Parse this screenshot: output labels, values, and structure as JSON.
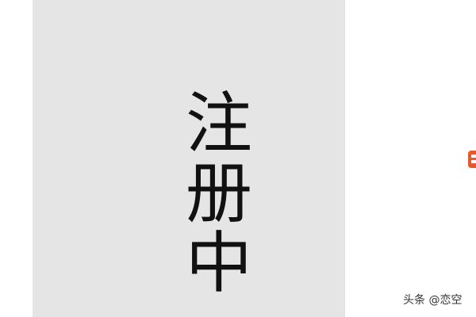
{
  "image": {
    "vertical_text_chars": [
      "注",
      "册",
      "中"
    ],
    "watermark": "头条 @恋空",
    "colors": {
      "panel_bg": "#e5e5e5",
      "text": "#111111",
      "accent_mark": "#e8582d",
      "watermark": "#333333"
    },
    "icons": {
      "side_mark": "partial-logo-icon"
    }
  }
}
